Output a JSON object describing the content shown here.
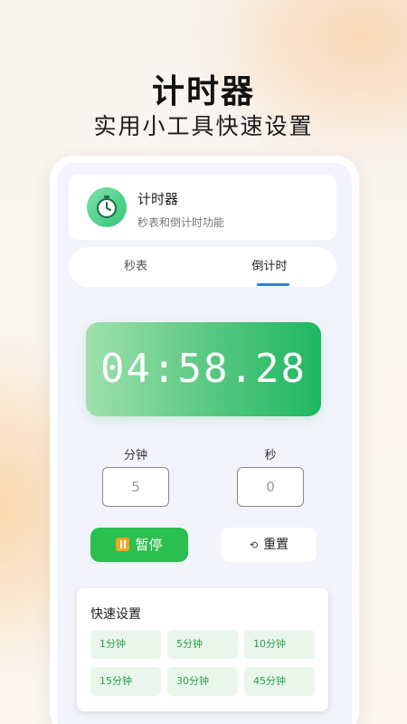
{
  "promo": {
    "title": "计时器",
    "subtitle": "实用小工具快速设置"
  },
  "app": {
    "name": "计时器",
    "description": "秒表和倒计时功能",
    "icon": "stopwatch-icon",
    "accent": "#2bbf4f"
  },
  "tabs": [
    {
      "label": "秒表",
      "active": false
    },
    {
      "label": "倒计时",
      "active": true
    }
  ],
  "timer": {
    "display": "04:58.28"
  },
  "inputs": {
    "minutes": {
      "label": "分钟",
      "value": "5"
    },
    "seconds": {
      "label": "秒",
      "value": "0"
    }
  },
  "buttons": {
    "pause": {
      "label": "暂停",
      "icon": "pause-icon"
    },
    "reset": {
      "label": "重置",
      "icon": "reset-icon",
      "glyph": "⟲"
    }
  },
  "quick_settings": {
    "title": "快速设置",
    "presets": [
      {
        "label": "1分钟"
      },
      {
        "label": "5分钟"
      },
      {
        "label": "10分钟"
      },
      {
        "label": "15分钟"
      },
      {
        "label": "30分钟"
      },
      {
        "label": "45分钟"
      }
    ]
  }
}
